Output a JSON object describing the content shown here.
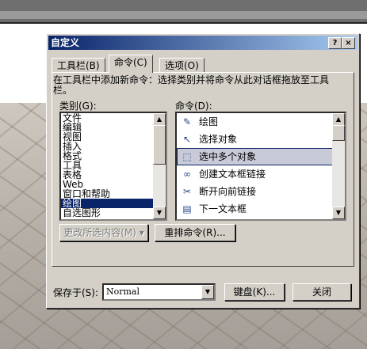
{
  "dialog": {
    "title": "自定义",
    "help_label": "?",
    "close_label": "×"
  },
  "tabs": [
    {
      "label": "工具栏(B)"
    },
    {
      "label": "命令(C)"
    },
    {
      "label": "选项(O)"
    }
  ],
  "instruction": "在工具栏中添加新命令：选择类别并将命令从此对话框拖放至工具栏。",
  "categories": {
    "label": "类别(G):",
    "items": [
      "文件",
      "编辑",
      "视图",
      "插入",
      "格式",
      "工具",
      "表格",
      "Web",
      "窗口和帮助",
      "绘图",
      "自选图形"
    ],
    "selected": "绘图"
  },
  "commands": {
    "label": "命令(D):",
    "items": [
      {
        "label": "绘图",
        "icon": "draw-icon"
      },
      {
        "label": "选择对象",
        "icon": "select-arrow-icon"
      },
      {
        "label": "选中多个对象",
        "icon": "multi-select-icon"
      },
      {
        "label": "创建文本框链接",
        "icon": "link-icon"
      },
      {
        "label": "断开向前链接",
        "icon": "break-link-icon"
      },
      {
        "label": "下一文本框",
        "icon": "next-textbox-icon"
      }
    ],
    "highlighted": "选中多个对象"
  },
  "buttons": {
    "modify_selection": "更改所选内容(M) ▾",
    "rearrange": "重排命令(R)...",
    "keyboard": "键盘(K)...",
    "close": "关闭"
  },
  "save_in": {
    "label": "保存于(S):",
    "value": "Normal"
  }
}
